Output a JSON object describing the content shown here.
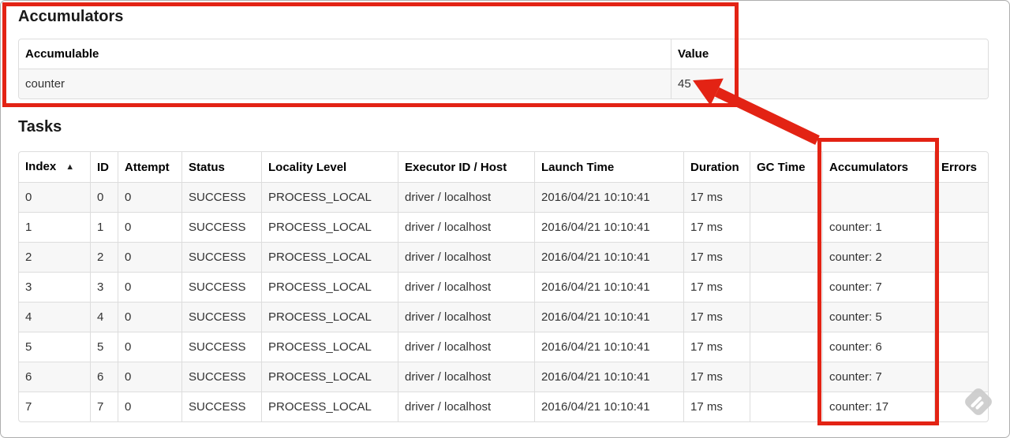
{
  "accumulators_section": {
    "title": "Accumulators",
    "table": {
      "col_accumulable": "Accumulable",
      "col_value": "Value",
      "rows": [
        {
          "accumulable": "counter",
          "value": "45"
        }
      ]
    }
  },
  "tasks_section": {
    "title": "Tasks",
    "table": {
      "headers": [
        "Index",
        "ID",
        "Attempt",
        "Status",
        "Locality Level",
        "Executor ID / Host",
        "Launch Time",
        "Duration",
        "GC Time",
        "Accumulators",
        "Errors"
      ],
      "sort_indicator": "▲",
      "rows": [
        {
          "index": "0",
          "id": "0",
          "attempt": "0",
          "status": "SUCCESS",
          "locality_level": "PROCESS_LOCAL",
          "executor_id_host": "driver / localhost",
          "launch_time": "2016/04/21 10:10:41",
          "duration": "17 ms",
          "gc_time": "",
          "accumulators": "",
          "errors": ""
        },
        {
          "index": "1",
          "id": "1",
          "attempt": "0",
          "status": "SUCCESS",
          "locality_level": "PROCESS_LOCAL",
          "executor_id_host": "driver / localhost",
          "launch_time": "2016/04/21 10:10:41",
          "duration": "17 ms",
          "gc_time": "",
          "accumulators": "counter: 1",
          "errors": ""
        },
        {
          "index": "2",
          "id": "2",
          "attempt": "0",
          "status": "SUCCESS",
          "locality_level": "PROCESS_LOCAL",
          "executor_id_host": "driver / localhost",
          "launch_time": "2016/04/21 10:10:41",
          "duration": "17 ms",
          "gc_time": "",
          "accumulators": "counter: 2",
          "errors": ""
        },
        {
          "index": "3",
          "id": "3",
          "attempt": "0",
          "status": "SUCCESS",
          "locality_level": "PROCESS_LOCAL",
          "executor_id_host": "driver / localhost",
          "launch_time": "2016/04/21 10:10:41",
          "duration": "17 ms",
          "gc_time": "",
          "accumulators": "counter: 7",
          "errors": ""
        },
        {
          "index": "4",
          "id": "4",
          "attempt": "0",
          "status": "SUCCESS",
          "locality_level": "PROCESS_LOCAL",
          "executor_id_host": "driver / localhost",
          "launch_time": "2016/04/21 10:10:41",
          "duration": "17 ms",
          "gc_time": "",
          "accumulators": "counter: 5",
          "errors": ""
        },
        {
          "index": "5",
          "id": "5",
          "attempt": "0",
          "status": "SUCCESS",
          "locality_level": "PROCESS_LOCAL",
          "executor_id_host": "driver / localhost",
          "launch_time": "2016/04/21 10:10:41",
          "duration": "17 ms",
          "gc_time": "",
          "accumulators": "counter: 6",
          "errors": ""
        },
        {
          "index": "6",
          "id": "6",
          "attempt": "0",
          "status": "SUCCESS",
          "locality_level": "PROCESS_LOCAL",
          "executor_id_host": "driver / localhost",
          "launch_time": "2016/04/21 10:10:41",
          "duration": "17 ms",
          "gc_time": "",
          "accumulators": "counter: 7",
          "errors": ""
        },
        {
          "index": "7",
          "id": "7",
          "attempt": "0",
          "status": "SUCCESS",
          "locality_level": "PROCESS_LOCAL",
          "executor_id_host": "driver / localhost",
          "launch_time": "2016/04/21 10:10:41",
          "duration": "17 ms",
          "gc_time": "",
          "accumulators": "counter: 17",
          "errors": ""
        }
      ]
    }
  },
  "annotations": {
    "highlight_color": "#e32314"
  },
  "watermark_icon": "feedly-logo"
}
